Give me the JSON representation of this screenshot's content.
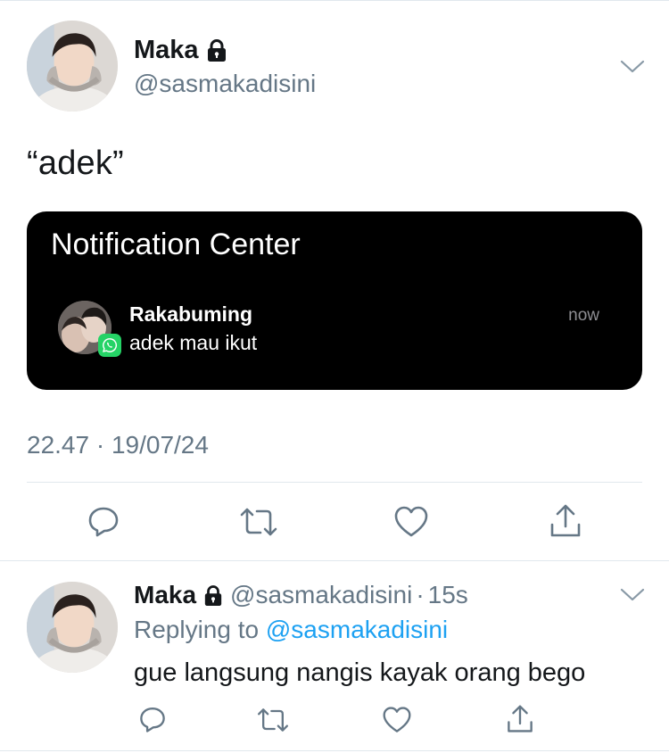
{
  "tweet": {
    "author": {
      "name": "Maka",
      "handle": "@sasmakadisini",
      "locked": true
    },
    "text": "“adek”",
    "attachment": {
      "notification_center": {
        "title": "Notification Center",
        "app_icon": "whatsapp-icon",
        "sender": "Rakabuming",
        "message": "adek mau ikut",
        "time": "now"
      }
    },
    "timestamp": "22.47 · 19/07/24",
    "actions": [
      "reply-icon",
      "retweet-icon",
      "like-icon",
      "share-icon"
    ]
  },
  "reply": {
    "author": {
      "name": "Maka",
      "handle": "@sasmakadisini",
      "locked": true
    },
    "separator": "·",
    "time": "15s",
    "replying_prefix": "Replying to ",
    "replying_to": "@sasmakadisini",
    "text": "gue langsung nangis kayak orang bego",
    "actions": [
      "reply-icon",
      "retweet-icon",
      "like-icon",
      "share-icon"
    ]
  },
  "colors": {
    "text_primary": "#14171a",
    "text_secondary": "#657786",
    "link": "#1da1f2",
    "divider": "#e1e8ed",
    "notification_bg": "#000000",
    "whatsapp_green": "#25d366"
  }
}
